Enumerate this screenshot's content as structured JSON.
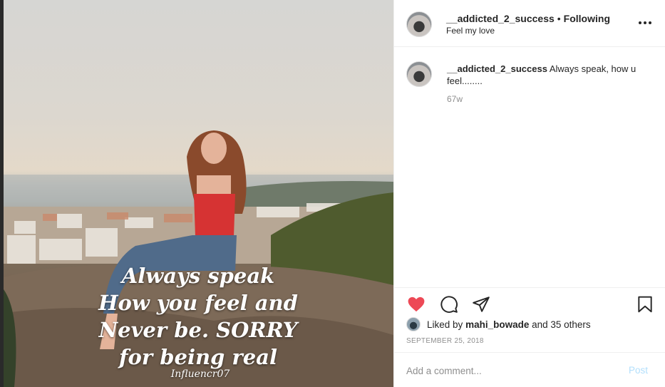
{
  "post": {
    "username": "__addicted_2_success",
    "follow_status": "Following",
    "separator": "•",
    "location": "Feel my love",
    "image": {
      "quote_lines": [
        "Always speak",
        "How you feel and",
        "Never be. SORRY",
        "for being real"
      ],
      "watermark": "Influencr07"
    }
  },
  "caption": {
    "username": "__addicted_2_success",
    "text": "Always speak, how u feel........",
    "age": "67w"
  },
  "actions": {
    "icons": [
      "heart-icon",
      "comment-icon",
      "share-icon",
      "bookmark-icon"
    ],
    "liked": true,
    "like_color": "#ed4956"
  },
  "likes": {
    "prefix": "Liked by",
    "user": "mahi_bowade",
    "suffix": "and 35 others"
  },
  "date": "SEPTEMBER 25, 2018",
  "add_comment": {
    "placeholder": "Add a comment...",
    "post_label": "Post"
  }
}
